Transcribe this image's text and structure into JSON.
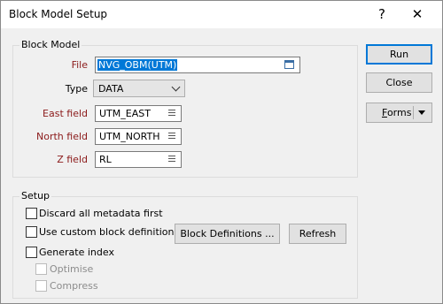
{
  "window": {
    "title": "Block Model Setup",
    "help_label": "?",
    "close_label": "✕"
  },
  "block_model": {
    "legend": "Block Model",
    "file": {
      "label": "File",
      "value": "NVG_OBM(UTM)"
    },
    "type": {
      "label": "Type",
      "value": "DATA"
    },
    "east_field": {
      "label": "East field",
      "value": "UTM_EAST"
    },
    "north_field": {
      "label": "North field",
      "value": "UTM_NORTH"
    },
    "z_field": {
      "label": "Z field",
      "value": "RL"
    }
  },
  "setup": {
    "legend": "Setup",
    "discard_metadata": {
      "label": "Discard all metadata first",
      "checked": false
    },
    "use_custom_defs": {
      "label": "Use custom block definitions",
      "checked": false
    },
    "generate_index": {
      "label": "Generate index",
      "checked": false
    },
    "optimise": {
      "label": "Optimise",
      "checked": false,
      "enabled": false
    },
    "compress": {
      "label": "Compress",
      "checked": false,
      "enabled": false
    },
    "block_definitions_button": "Block Definitions ...",
    "refresh_button": "Refresh"
  },
  "actions": {
    "run": "Run",
    "close": "Close",
    "forms_prefix": "F",
    "forms_rest": "orms"
  },
  "colors": {
    "required_label": "#8b1a1a",
    "selection": "#0078d7",
    "background": "#f0f0f0"
  }
}
